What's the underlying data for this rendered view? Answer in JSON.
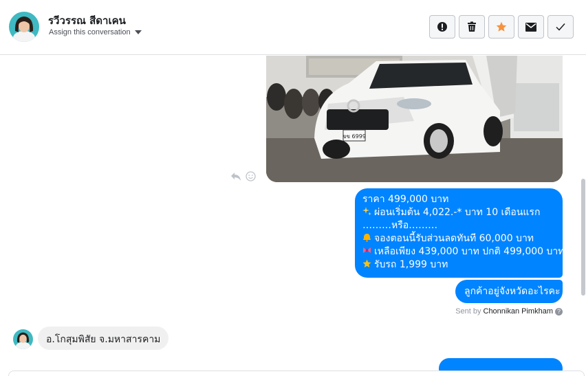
{
  "header": {
    "contact_name": "รวีวรรณ สีดาเคน",
    "assign_label": "Assign this conversation"
  },
  "actions": [
    {
      "name": "alert-button",
      "icon": "exclamation-circle-icon"
    },
    {
      "name": "delete-button",
      "icon": "trash-icon"
    },
    {
      "name": "star-button",
      "icon": "star-icon",
      "color": "#f7923b"
    },
    {
      "name": "email-button",
      "icon": "envelope-icon"
    },
    {
      "name": "done-button",
      "icon": "checkmark-icon"
    }
  ],
  "messages": {
    "price": {
      "lines": [
        "ราคา 499,000 บาท",
        "ผ่อนเริ่มต้น 4,022.-* บาท 10 เดือนแรก",
        "………หรือ………",
        "จองตอนนี้รับส่วนลดทันที 60,000 บาท",
        "เหลือเพียง 439,000 บาท ปกติ 499,000 บาท",
        "รับรถ 1,999 บาท"
      ],
      "emoji_icons": [
        "sparkles-icon",
        "",
        "",
        "bell-icon",
        "ribbon-icon",
        "star-icon"
      ]
    },
    "question": "ลูกค้าอยู่จังหวัดอะไรคะ",
    "sent_by_prefix": "Sent by",
    "sent_by_name": "Chonnikan Pimkham",
    "reply": "อ.โกสุมพิสัย จ.มหาสารคาม"
  },
  "colors": {
    "outgoing_bubble": "#0084ff",
    "incoming_bubble": "#f1f0f0",
    "star_accent": "#f7923b"
  }
}
